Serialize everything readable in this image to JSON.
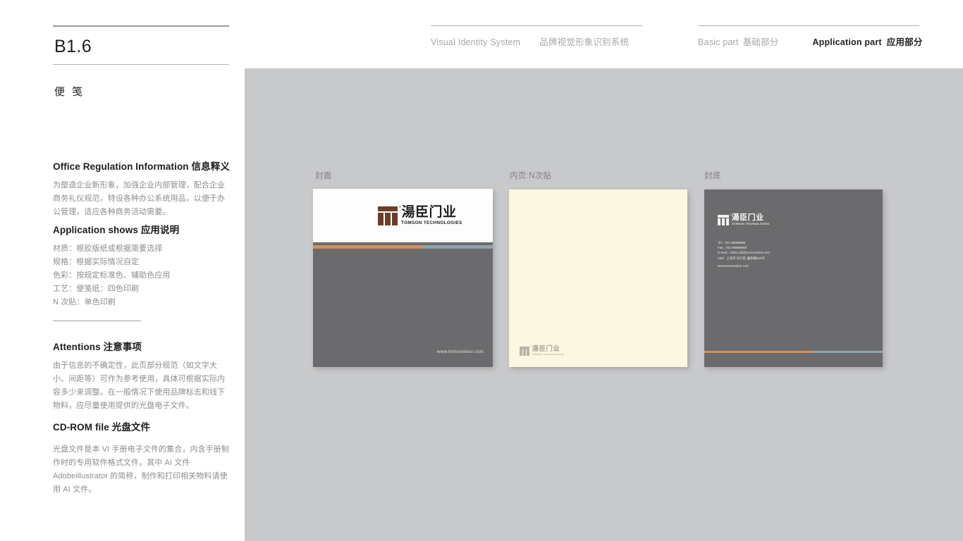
{
  "header": {
    "left_en": "Visual Identity System",
    "left_cn": "品牌视觉形象识别系统",
    "basic_en": "Basic part",
    "basic_cn": "基础部分",
    "application_en": "Application part",
    "application_cn": "应用部分"
  },
  "sidebar": {
    "section_number": "B1.6",
    "section_title": "便 笺",
    "blocks": [
      {
        "heading_en": "Office Regulation Information",
        "heading_cn": "信息释义",
        "body": "为塑造企业新形象，加强企业内部管理，配合企业商务礼仪规范，特设各种办公系统用品，以便于办公管理，适应各种商务活动需要。"
      },
      {
        "heading_en": "Application shows",
        "heading_cn": "应用说明",
        "lines": [
          "材质：根胶版纸或根据需要选择",
          "规格：根据实际情况自定",
          "色彩：按规定标准色、辅助色应用",
          "工艺：便笺纸：四色印刷",
          "N 次贴：单色印刷"
        ]
      },
      {
        "heading_en": "Attentions",
        "heading_cn": "注意事项",
        "body": "由于信息的不确定性，此页部分规范（如文字大小、间距等）可作为参考使用，具体可根据实际内容多少来调整。在一般情况下使用品牌标志和线下物料，应尽量使用提供的光盘电子文件。"
      },
      {
        "heading_en": "CD-ROM file",
        "heading_cn": "光盘文件",
        "body": "光盘文件是本 VI 手册电子文件的集合，内含手册制作时的专用软件格式文件。其中 AI 文件 Adobeillustrator 的简称，制作和打印相关物料请使用 AI 文件。"
      }
    ]
  },
  "stage": {
    "captions": {
      "front": "封面",
      "inner": "内页:N次贴",
      "back": "封底"
    },
    "logo": {
      "registered": "®",
      "cn": "湯臣门业",
      "en": "TOMSON TECHNOLOGIES"
    },
    "card_front": {
      "url": "www.tomsondoor.com"
    },
    "card_back": {
      "tel": "Tel：021-88888888",
      "fax": "Fax：021-88888888",
      "email": "E-mail：calvin.shi@tomsondoor.com",
      "address": "Add：上海市·虹口区·曲阳路518号",
      "web": "www.tomsondoor.com"
    }
  },
  "colors": {
    "stage_bg": "#c8c9cb",
    "card_dark": "#6b6a6d",
    "card_note": "#fbf7e0",
    "accent_orange": "#d28e5b",
    "accent_blue": "#8fa3ad",
    "logo_brown": "#6d3d27"
  }
}
